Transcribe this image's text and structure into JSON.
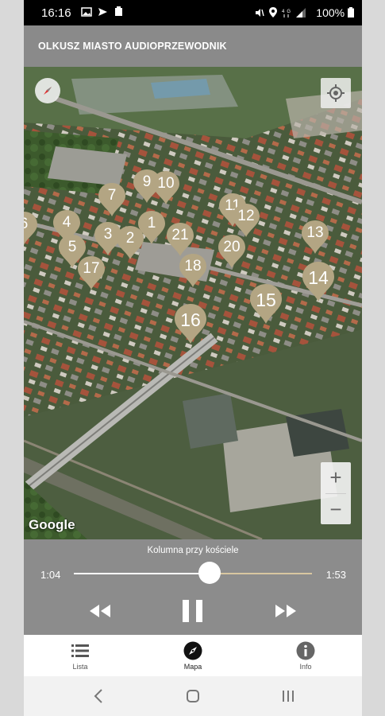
{
  "status_bar": {
    "time": "16:16",
    "left_icons": [
      "image-icon",
      "send-icon",
      "clipboard-icon"
    ],
    "right_icons": [
      "mute-icon",
      "location-icon",
      "network-4g-icon",
      "signal-icon"
    ],
    "battery": "100%"
  },
  "header": {
    "title": "OLKUSZ MIASTO AUDIOPRZEWODNIK"
  },
  "map": {
    "attribution": "Google",
    "zoom_in": "+",
    "zoom_out": "−",
    "pin_color": "#b3a583",
    "markers": [
      "6",
      "4",
      "5",
      "17",
      "7",
      "3",
      "2",
      "1",
      "9",
      "10",
      "21",
      "18",
      "11",
      "12",
      "20",
      "13",
      "14",
      "15",
      "16"
    ]
  },
  "player": {
    "track_title": "Kolumna przy kościele",
    "current_time": "1:04",
    "total_time": "1:53",
    "progress": 0.57,
    "accent": "#d8c7a0"
  },
  "bottom_nav": {
    "items": [
      {
        "label": "Lista",
        "icon": "list-icon"
      },
      {
        "label": "Mapa",
        "icon": "compass-icon"
      },
      {
        "label": "Info",
        "icon": "info-icon"
      }
    ],
    "active": "Mapa"
  }
}
